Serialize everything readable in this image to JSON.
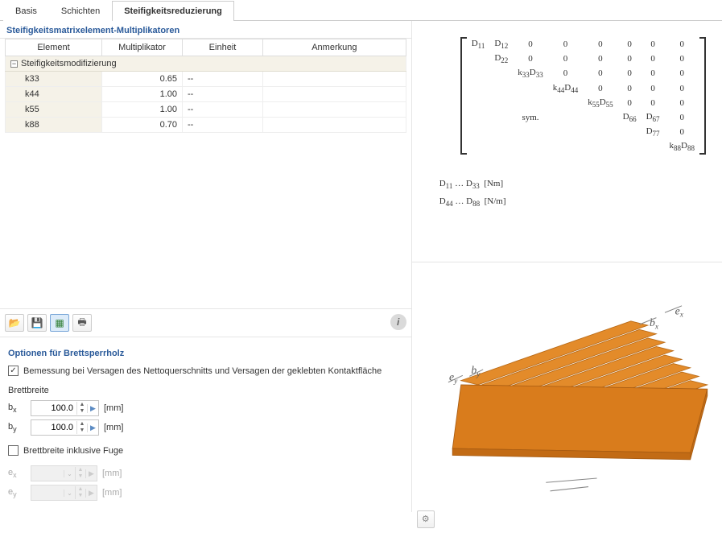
{
  "tabs": [
    {
      "label": "Basis",
      "active": false
    },
    {
      "label": "Schichten",
      "active": false
    },
    {
      "label": "Steifigkeitsreduzierung",
      "active": true
    }
  ],
  "multipliers_panel": {
    "title": "Steifigkeitsmatrixelement-Multiplikatoren",
    "headers": {
      "element": "Element",
      "multiplikator": "Multiplikator",
      "einheit": "Einheit",
      "anmerkung": "Anmerkung"
    },
    "group_row": "Steifigkeitsmodifizierung",
    "rows": [
      {
        "name": "k33",
        "value": "0.65",
        "unit": "--"
      },
      {
        "name": "k44",
        "value": "1.00",
        "unit": "--"
      },
      {
        "name": "k55",
        "value": "1.00",
        "unit": "--"
      },
      {
        "name": "k88",
        "value": "0.70",
        "unit": "--"
      }
    ]
  },
  "options_panel": {
    "title": "Optionen für Brettsperrholz",
    "checkbox1": {
      "checked": true,
      "label": "Bemessung bei Versagen des Nettoquerschnitts und Versagen der geklebten Kontaktfläche"
    },
    "brettbreite_label": "Brettbreite",
    "bx": {
      "label": "bx",
      "value": "100.0",
      "unit": "[mm]"
    },
    "by": {
      "label": "by",
      "value": "100.0",
      "unit": "[mm]"
    },
    "checkbox2": {
      "checked": false,
      "label": "Brettbreite inklusive Fuge"
    },
    "ex": {
      "label": "ex",
      "value": "",
      "unit": "[mm]"
    },
    "ey": {
      "label": "ey",
      "value": "",
      "unit": "[mm]"
    }
  },
  "matrix": {
    "cells": [
      [
        "D11",
        "D12",
        "0",
        "0",
        "0",
        "0",
        "0",
        "0"
      ],
      [
        "",
        "D22",
        "0",
        "0",
        "0",
        "0",
        "0",
        "0"
      ],
      [
        "",
        "",
        "k33D33",
        "0",
        "0",
        "0",
        "0",
        "0"
      ],
      [
        "",
        "",
        "",
        "k44D44",
        "0",
        "0",
        "0",
        "0"
      ],
      [
        "",
        "",
        "",
        "",
        "k55D55",
        "0",
        "0",
        "0"
      ],
      [
        "",
        "",
        "sym.",
        "",
        "",
        "D66",
        "D67",
        "0"
      ],
      [
        "",
        "",
        "",
        "",
        "",
        "",
        "D77",
        "0"
      ],
      [
        "",
        "",
        "",
        "",
        "",
        "",
        "",
        "k88D88"
      ]
    ],
    "legend1": "D11 … D33  [Nm]",
    "legend2": "D44 … D88  [N/m]"
  },
  "diagram_labels": {
    "ex": "ex",
    "bx": "bx",
    "ey": "ey",
    "by": "by"
  }
}
